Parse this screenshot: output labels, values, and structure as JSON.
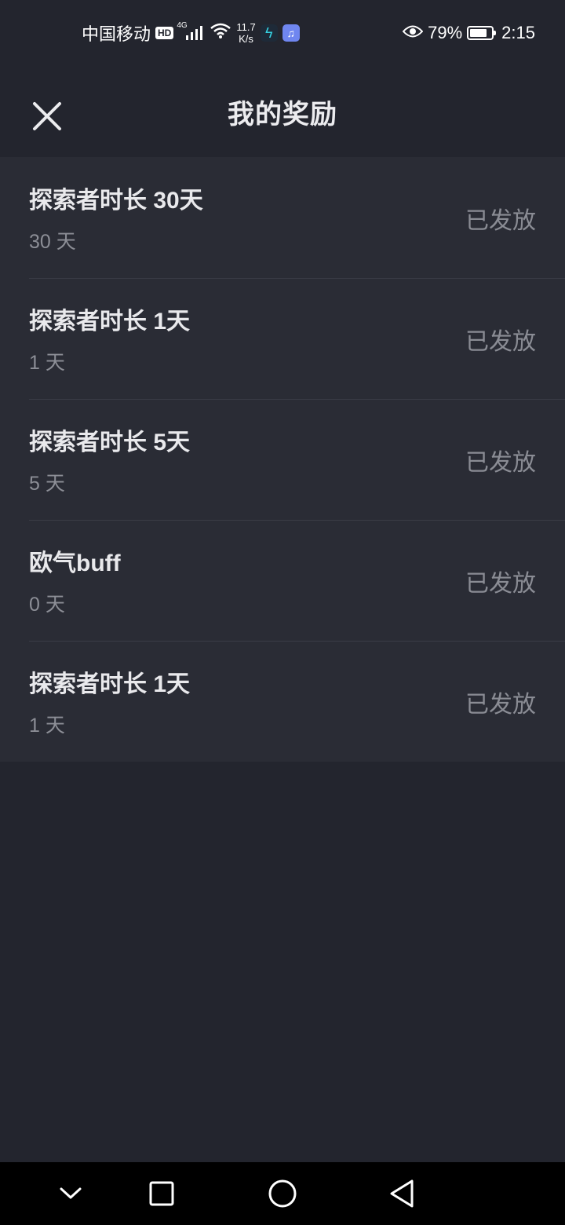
{
  "status_bar": {
    "carrier": "中国移动",
    "hd": "HD",
    "network": "4G",
    "speed_value": "11.7",
    "speed_unit": "K/s",
    "battery_percent": "79%",
    "battery_level": 0.79,
    "time": "2:15"
  },
  "header": {
    "title": "我的奖励"
  },
  "rewards": [
    {
      "name": "探索者时长 30天",
      "duration": "30 天",
      "status": "已发放"
    },
    {
      "name": "探索者时长 1天",
      "duration": "1 天",
      "status": "已发放"
    },
    {
      "name": "探索者时长 5天",
      "duration": "5 天",
      "status": "已发放"
    },
    {
      "name": "欧气buff",
      "duration": "0 天",
      "status": "已发放"
    },
    {
      "name": "探索者时长 1天",
      "duration": "1 天",
      "status": "已发放"
    }
  ],
  "icons": {
    "close": "close-icon",
    "nav_down": "chevron-down-icon",
    "nav_recent": "square-icon",
    "nav_home": "circle-icon",
    "nav_back": "triangle-back-icon"
  }
}
